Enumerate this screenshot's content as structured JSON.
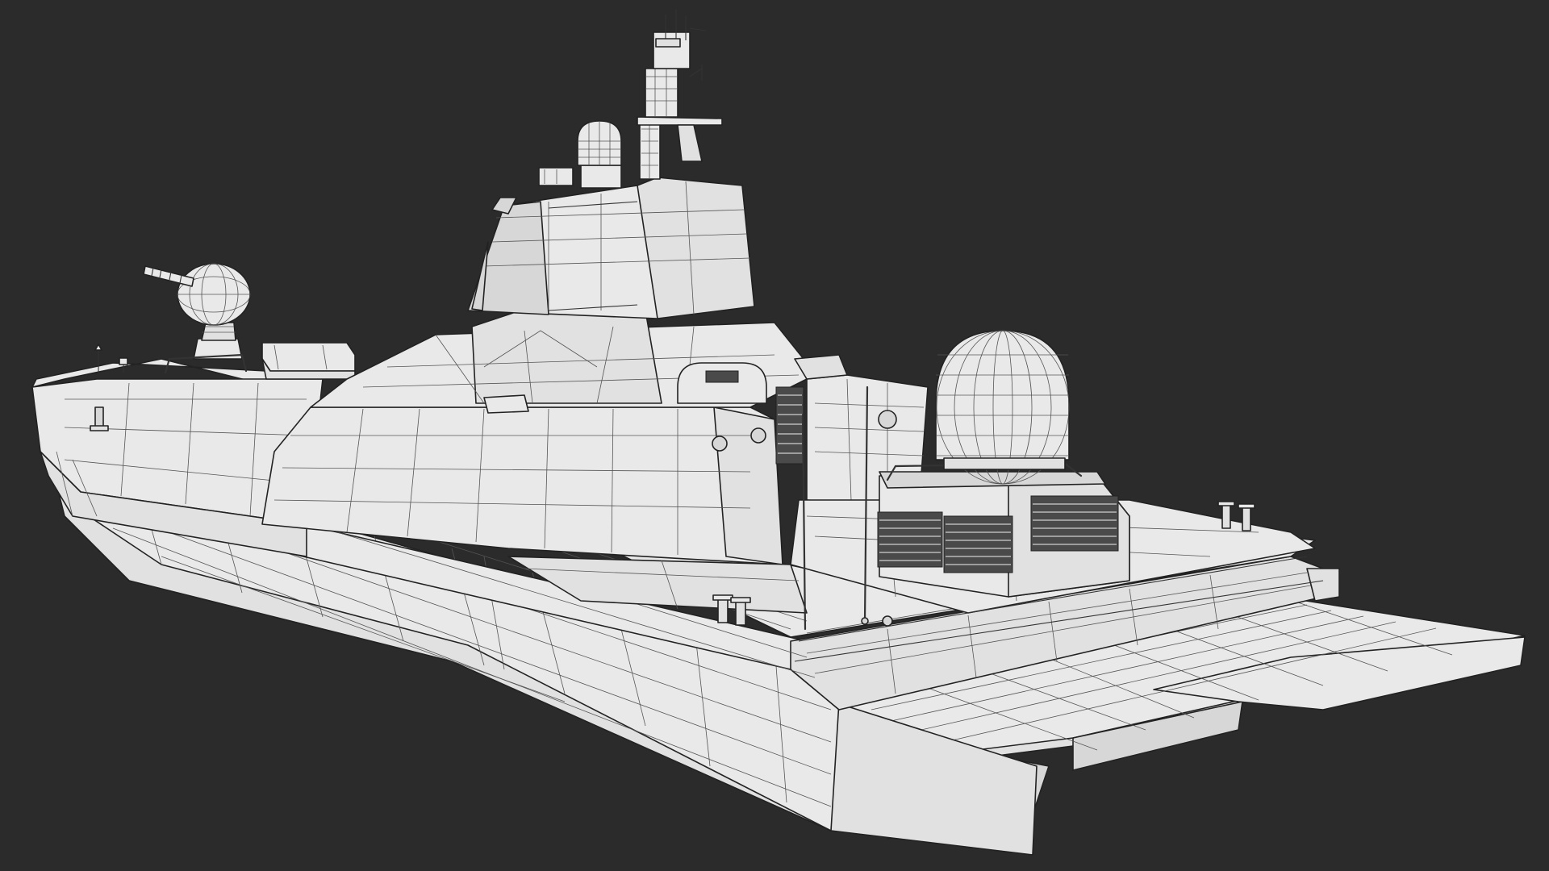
{
  "viewport": {
    "background_color": "#2b2b2b",
    "render_mode": "wireframe-on-shaded",
    "model_fill_color": "#e9e9e9",
    "wire_color": "#222222"
  },
  "model": {
    "subject": "ship-hull"
  }
}
